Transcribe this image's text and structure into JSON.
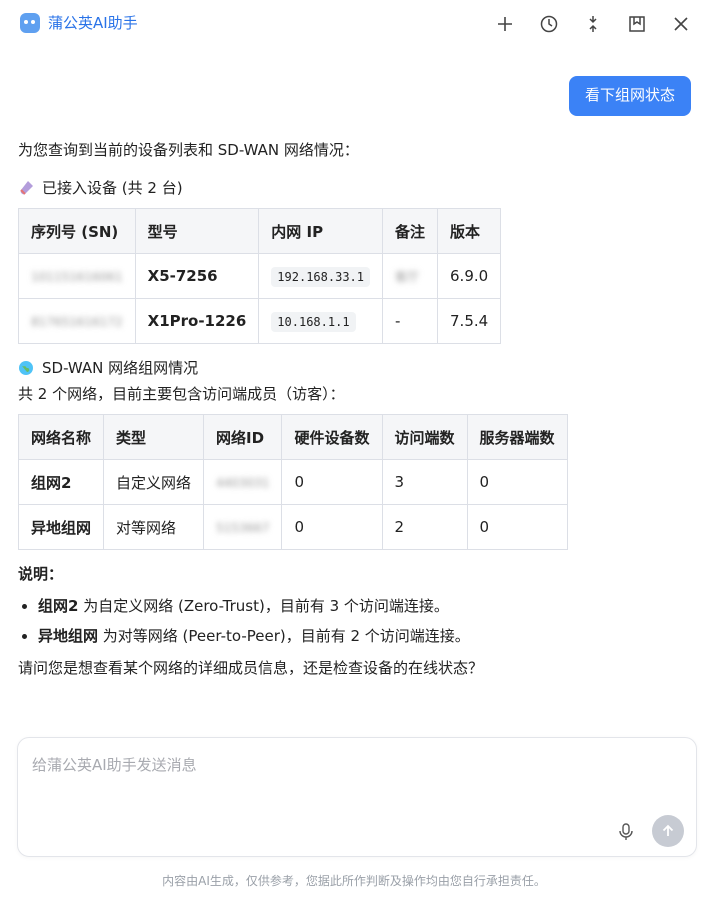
{
  "header": {
    "title": "蒲公英AI助手"
  },
  "user_message": {
    "text": "看下组网状态"
  },
  "assistant": {
    "intro": "为您查询到当前的设备列表和 SD-WAN 网络情况：",
    "devices_heading": "已接入设备 (共 2 台)",
    "devices_table": {
      "headers": [
        "序列号 (SN)",
        "型号",
        "内网 IP",
        "备注",
        "版本"
      ],
      "rows": [
        [
          "101151616061",
          "X5-7256",
          "192.168.33.1",
          "客厅",
          "6.9.0"
        ],
        [
          "817651616172",
          "X1Pro-1226",
          "10.168.1.1",
          "-",
          "7.5.4"
        ]
      ]
    },
    "network_heading": "SD-WAN 网络组网情况",
    "network_summary": "共 2 个网络，目前主要包含访问端成员（访客）：",
    "network_table": {
      "headers": [
        "网络名称",
        "类型",
        "网络ID",
        "硬件设备数",
        "访问端数",
        "服务器端数"
      ],
      "rows": [
        [
          "组网2",
          "自定义网络",
          "4403031",
          "0",
          "3",
          "0"
        ],
        [
          "异地组网",
          "对等网络",
          "5153667",
          "0",
          "2",
          "0"
        ]
      ]
    },
    "notes_title": "说明：",
    "notes": [
      {
        "name": "组网2",
        "text": " 为自定义网络 (Zero-Trust)，目前有 3 个访问端连接。"
      },
      {
        "name": "异地组网",
        "text": " 为对等网络 (Peer-to-Peer)，目前有 2 个访问端连接。"
      }
    ],
    "question": "请问您是想查看某个网络的详细成员信息，还是检查设备的在线状态？"
  },
  "composer": {
    "placeholder": "给蒲公英AI助手发送消息"
  },
  "footer": {
    "disclaimer": "内容由AI生成，仅供参考，您据此所作判断及操作均由您自行承担责任。"
  }
}
